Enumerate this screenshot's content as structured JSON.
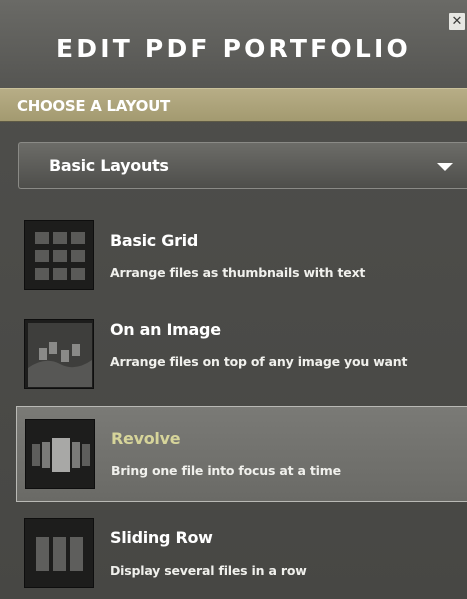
{
  "header": {
    "title": "EDIT PDF PORTFOLIO",
    "close_glyph": "✕"
  },
  "section": {
    "label": "CHOOSE A LAYOUT"
  },
  "layout_select": {
    "value": "Basic Layouts"
  },
  "layouts": [
    {
      "title": "Basic Grid",
      "description": "Arrange files as thumbnails with text",
      "icon": "grid-layout-icon",
      "selected": false
    },
    {
      "title": "On an Image",
      "description": "Arrange files on top of any image you want",
      "icon": "image-layout-icon",
      "selected": false
    },
    {
      "title": "Revolve",
      "description": "Bring one file into focus at a time",
      "icon": "revolve-layout-icon",
      "selected": true
    },
    {
      "title": "Sliding Row",
      "description": "Display several files in a row",
      "icon": "sliding-row-layout-icon",
      "selected": false
    }
  ],
  "colors": {
    "accent_section": "#a39a70",
    "selected_title": "#d6d49a"
  }
}
